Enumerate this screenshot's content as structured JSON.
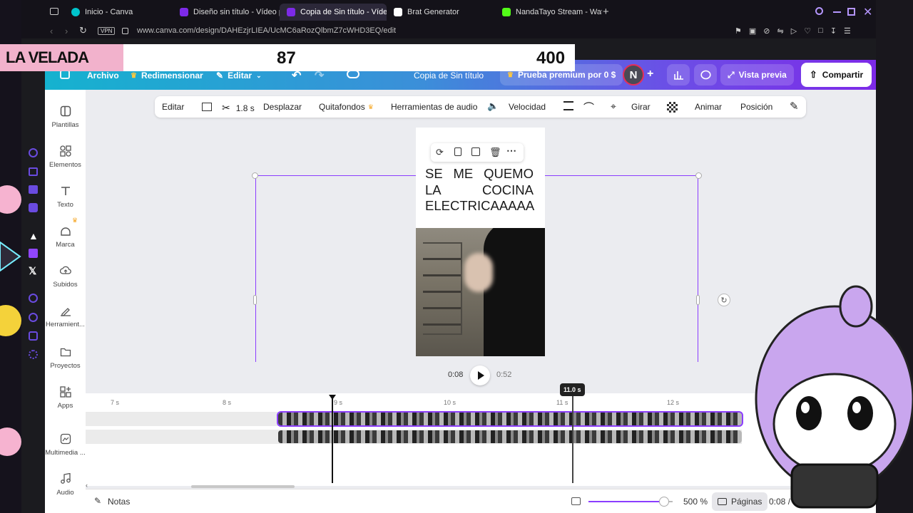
{
  "browser": {
    "tabs": [
      {
        "label": "Inicio - Canva",
        "color": "#00c4cc"
      },
      {
        "label": "Diseño sin título - Vídeo p",
        "color": "#7d2ae8"
      },
      {
        "label": "Copia de Sin título - Vídeo",
        "color": "#7d2ae8",
        "active": true
      },
      {
        "label": "Brat Generator",
        "color": "#ffffff"
      },
      {
        "label": "NandaTayo Stream - Watc",
        "color": "#53fc18"
      }
    ],
    "url": "www.canva.com/design/DAHEzjrLIEA/UcMC6aRozQlbmZ7cWHD3EQ/edit",
    "vpn": "VPN"
  },
  "overlay": {
    "label": "LA VELADA",
    "score_left": "87",
    "score_right": "400"
  },
  "header": {
    "archivo": "Archivo",
    "redimensionar": "Redimensionar",
    "editar": "Editar",
    "title": "Copia de Sin título",
    "premium": "Prueba premium por 0 $",
    "avatar": "N",
    "vista_previa": "Vista previa",
    "compartir": "Compartir"
  },
  "sidebar": {
    "items": [
      {
        "label": "Plantillas",
        "icon": "templates-icon"
      },
      {
        "label": "Elementos",
        "icon": "elements-icon"
      },
      {
        "label": "Texto",
        "icon": "text-icon"
      },
      {
        "label": "Marca",
        "icon": "brand-icon"
      },
      {
        "label": "Subidos",
        "icon": "upload-icon"
      },
      {
        "label": "Herramient...",
        "icon": "tools-icon"
      },
      {
        "label": "Proyectos",
        "icon": "folder-icon"
      },
      {
        "label": "Apps",
        "icon": "apps-icon"
      },
      {
        "label": "Multimedia ...",
        "icon": "media-icon"
      },
      {
        "label": "Audio",
        "icon": "audio-icon"
      }
    ]
  },
  "toolbar": {
    "editar": "Editar",
    "duration": "1.8 s",
    "desplazar": "Desplazar",
    "quitafondos": "Quitafondos",
    "audio_tools": "Herramientas de audio",
    "velocidad": "Velocidad",
    "girar": "Girar",
    "animar": "Animar",
    "posicion": "Posición"
  },
  "canvas": {
    "line1": [
      "SE",
      "ME",
      "QUEMO"
    ],
    "line2": [
      "LA",
      "COCINA"
    ],
    "line3": [
      "ELECTRICAAAAA"
    ]
  },
  "playback": {
    "current": "0:08",
    "total": "0:52"
  },
  "timeline": {
    "ticks": [
      "7 s",
      "8 s",
      "9 s",
      "10 s",
      "11 s",
      "12 s"
    ],
    "marker": "11.0 s"
  },
  "footer": {
    "notas": "Notas",
    "zoom": "500 %",
    "zoom_level": 0.9,
    "paginas": "Páginas",
    "time": "0:08 / 0"
  }
}
